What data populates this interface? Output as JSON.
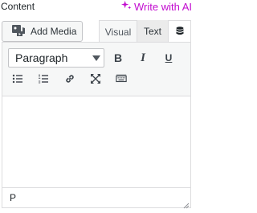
{
  "header": {
    "content_label": "Content",
    "ai_link_label": "Write with AI",
    "ai_color": "#c20ccf"
  },
  "media": {
    "add_media_label": "Add Media"
  },
  "tabs": [
    {
      "label": "Visual"
    },
    {
      "label": "Text"
    }
  ],
  "toolbar": {
    "format_select_value": "Paragraph",
    "bold": "B",
    "italic": "I",
    "underline": "U"
  },
  "editor": {
    "body_text": "",
    "status_path": "P"
  }
}
